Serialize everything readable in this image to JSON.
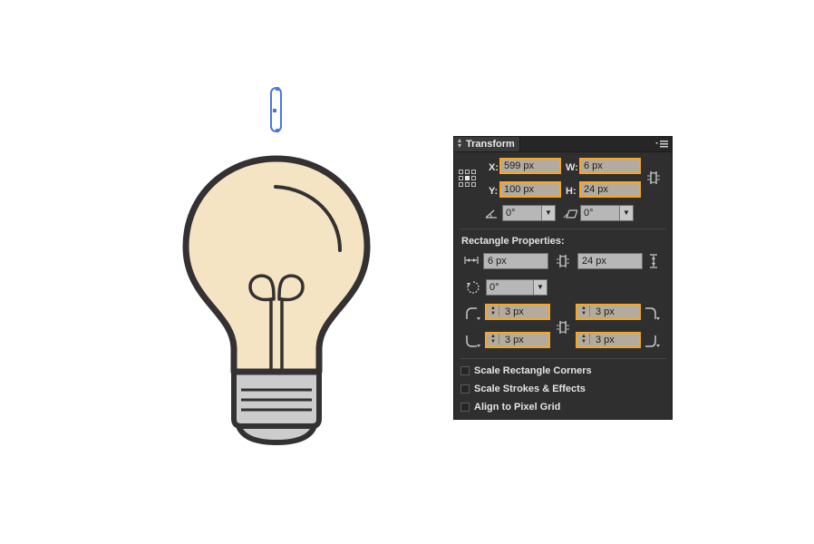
{
  "panel": {
    "title": "Transform",
    "x": {
      "label": "X:",
      "value": "599 px"
    },
    "y": {
      "label": "Y:",
      "value": "100 px"
    },
    "w": {
      "label": "W:",
      "value": "6 px"
    },
    "h": {
      "label": "H:",
      "value": "24 px"
    },
    "angle": "0°",
    "shear": "0°",
    "rect_props": {
      "heading": "Rectangle Properties:",
      "width": "6 px",
      "height": "24 px",
      "rotation": "0°",
      "corner_tl": "3 px",
      "corner_tr": "3 px",
      "corner_bl": "3 px",
      "corner_br": "3 px"
    },
    "options": [
      {
        "label": "Scale Rectangle Corners",
        "checked": false
      },
      {
        "label": "Scale Strokes & Effects",
        "checked": false
      },
      {
        "label": "Align to Pixel Grid",
        "checked": false
      }
    ]
  },
  "colors": {
    "bulb_fill": "#f5e4c3",
    "outline": "#333132",
    "base_fill": "#cccccc",
    "selection": "#4a78e0",
    "highlight": "#f5a623",
    "panel_bg": "#2f2f2f"
  }
}
